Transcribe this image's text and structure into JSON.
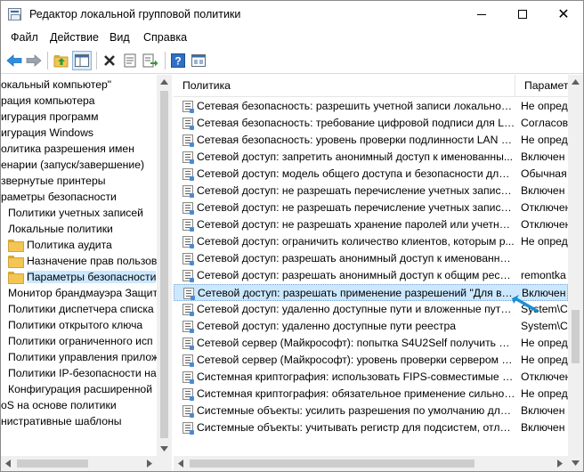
{
  "window": {
    "title": "Редактор локальной групповой политики"
  },
  "menu": [
    "Файл",
    "Действие",
    "Вид",
    "Справка"
  ],
  "toolbar": {
    "buttons": [
      "back-icon",
      "forward-icon",
      "up-folder-icon",
      "show-tree-icon",
      "delete-icon",
      "properties-icon",
      "export-icon",
      "help-icon",
      "view-icon"
    ]
  },
  "tree": {
    "items": [
      "окальный компьютер\"",
      "рация компьютера",
      "игурация программ",
      "игурация Windows",
      "олитика разрешения имен",
      "енарии (запуск/завершение)",
      "звернутые принтеры",
      "раметры безопасности",
      "Политики учетных записей",
      "Локальные политики",
      "Политика аудита",
      "Назначение прав пользова",
      "Параметры безопасности",
      "Монитор брандмауэра Защит",
      "Политики диспетчера списка",
      "Политики открытого ключа",
      "Политики ограниченного исп",
      "Политики управления прилож",
      "Политики IP-безопасности на",
      "Конфигурация расширенной",
      "оS на основе политики",
      "нистративные шаблоны"
    ]
  },
  "table": {
    "columns": [
      "Политика",
      "Параметр"
    ],
    "rows": [
      {
        "name": "Сетевая безопасность: разрешить учетной записи локальной ...",
        "setting": "Не опред"
      },
      {
        "name": "Сетевая безопасность: требование цифровой подписи для LD...",
        "setting": "Согласов"
      },
      {
        "name": "Сетевая безопасность: уровень проверки подлинности LAN M...",
        "setting": "Не опред"
      },
      {
        "name": "Сетевой доступ: запретить анонимный доступ к именованны...",
        "setting": "Включен"
      },
      {
        "name": "Сетевой доступ: модель общего доступа и безопасности для л...",
        "setting": "Обычная"
      },
      {
        "name": "Сетевой доступ: не разрешать перечисление учетных записей ...",
        "setting": "Включен"
      },
      {
        "name": "Сетевой доступ: не разрешать перечисление учетных записей ...",
        "setting": "Отключен"
      },
      {
        "name": "Сетевой доступ: не разрешать хранение паролей или учетных ...",
        "setting": "Отключен"
      },
      {
        "name": "Сетевой доступ: ограничить количество клиентов, которым р...",
        "setting": "Не опред"
      },
      {
        "name": "Сетевой доступ: разрешать анонимный доступ к именованны...",
        "setting": ""
      },
      {
        "name": "Сетевой доступ: разрешать анонимный доступ к общим ресур...",
        "setting": "remontka"
      },
      {
        "name": "Сетевой доступ: разрешать применение разрешений \"Для все...",
        "setting": "Включен"
      },
      {
        "name": "Сетевой доступ: удаленно доступные пути и вложенные пути ...",
        "setting": "System\\C"
      },
      {
        "name": "Сетевой доступ: удаленно доступные пути реестра",
        "setting": "System\\C"
      },
      {
        "name": "Сетевой сервер (Майкрософт): попытка S4U2Self получить ин...",
        "setting": "Не опред"
      },
      {
        "name": "Сетевой сервер (Майкрософт): уровень проверки сервером и...",
        "setting": "Не опред"
      },
      {
        "name": "Системная криптография: использовать FIPS-совместимые ал...",
        "setting": "Отключен"
      },
      {
        "name": "Системная криптография: обязательное применение сильной...",
        "setting": "Не опред"
      },
      {
        "name": "Системные объекты: усилить разрешения по умолчанию для ...",
        "setting": "Включен"
      },
      {
        "name": "Системные объекты: учитывать регистр для подсистем, отлич...",
        "setting": "Включен"
      }
    ],
    "selected_index": 11
  },
  "colors": {
    "selection": "#cce8ff",
    "pointer": "#1a8fd8"
  }
}
